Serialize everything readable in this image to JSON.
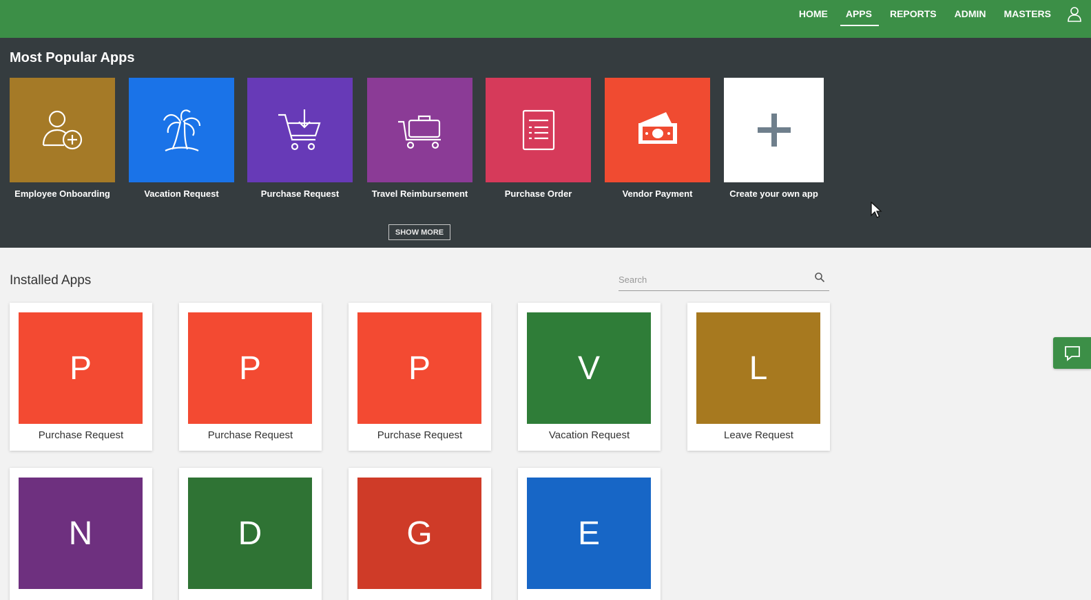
{
  "header": {
    "nav": [
      "HOME",
      "APPS",
      "REPORTS",
      "ADMIN",
      "MASTERS"
    ],
    "active": "APPS",
    "user_icon": "user-icon"
  },
  "popular": {
    "title": "Most Popular Apps",
    "tiles": [
      {
        "label": "Employee Onboarding",
        "color": "#a57a27",
        "icon": "add-user-icon"
      },
      {
        "label": "Vacation Request",
        "color": "#1a73e8",
        "icon": "palm-tree-icon"
      },
      {
        "label": "Purchase Request",
        "color": "#673ab7",
        "icon": "cart-icon"
      },
      {
        "label": "Travel Reimbursement",
        "color": "#8b3b96",
        "icon": "luggage-cart-icon"
      },
      {
        "label": "Purchase Order",
        "color": "#d63a5a",
        "icon": "document-list-icon"
      },
      {
        "label": "Vendor Payment",
        "color": "#f04b31",
        "icon": "money-icon"
      },
      {
        "label": "Create your own app",
        "color": "#ffffff",
        "icon": "plus-icon"
      }
    ],
    "show_more": "SHOW MORE"
  },
  "installed": {
    "title": "Installed Apps",
    "search_placeholder": "Search",
    "apps": [
      {
        "letter": "P",
        "label": "Purchase Request",
        "color": "#f34a32"
      },
      {
        "letter": "P",
        "label": "Purchase Request",
        "color": "#f34a32"
      },
      {
        "letter": "P",
        "label": "Purchase Request",
        "color": "#f34a32"
      },
      {
        "letter": "V",
        "label": "Vacation Request",
        "color": "#2f7d38"
      },
      {
        "letter": "L",
        "label": "Leave Request",
        "color": "#a7791f"
      },
      {
        "letter": "N",
        "label": "",
        "color": "#6e307f"
      },
      {
        "letter": "D",
        "label": "",
        "color": "#2f7334"
      },
      {
        "letter": "G",
        "label": "",
        "color": "#cf3b28"
      },
      {
        "letter": "E",
        "label": "",
        "color": "#1766c6"
      }
    ]
  },
  "colors": {
    "header": "#3c8f47",
    "popular_bg": "#353c3f",
    "page_bg": "#f2f2f2"
  }
}
